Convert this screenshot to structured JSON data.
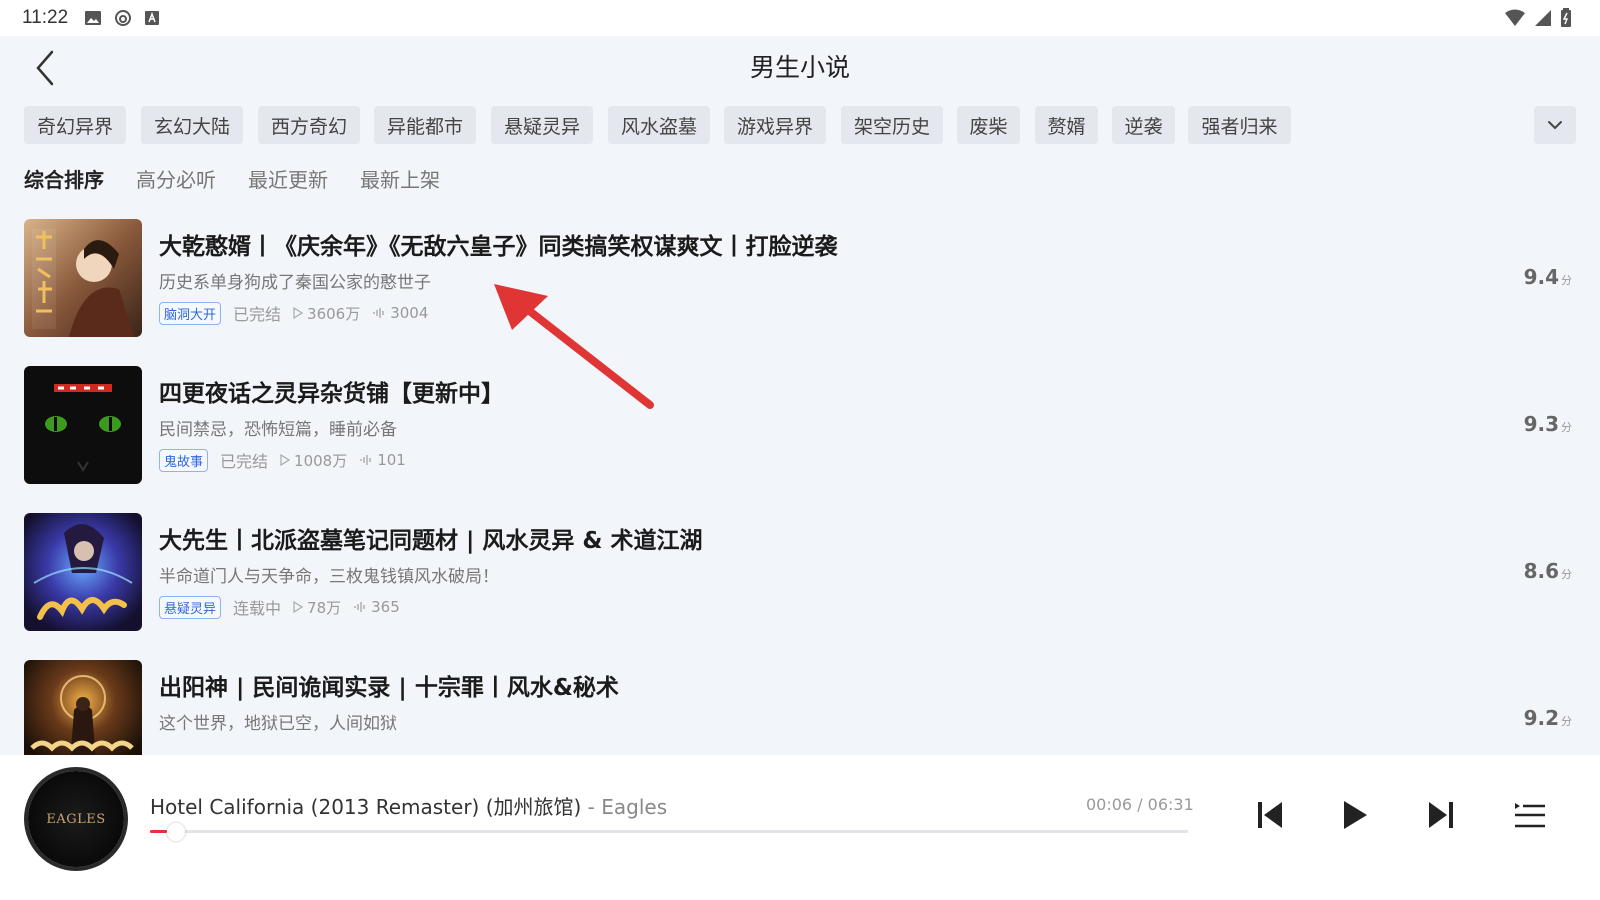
{
  "status_bar": {
    "time": "11:22"
  },
  "header": {
    "title": "男生小说"
  },
  "tags": [
    "奇幻异界",
    "玄幻大陆",
    "西方奇幻",
    "异能都市",
    "悬疑灵异",
    "风水盗墓",
    "游戏异界",
    "架空历史",
    "废柴",
    "赘婿",
    "逆袭",
    "强者归来"
  ],
  "sort_options": [
    "综合排序",
    "高分必听",
    "最近更新",
    "最新上架"
  ],
  "books": [
    {
      "title": "大乾憨婿丨《庆余年》《无敌六皇子》同类搞笑权谋爽文丨打脸逆袭",
      "desc": "历史系单身狗成了秦国公家的憨世子",
      "badge": "脑洞大开",
      "status": "已完结",
      "plays": "3606万",
      "count": "3004",
      "score": "9.4",
      "score_unit": "分"
    },
    {
      "title": "四更夜话之灵异杂货铺【更新中】",
      "desc": "民间禁忌，恐怖短篇，睡前必备",
      "badge": "鬼故事",
      "status": "已完结",
      "plays": "1008万",
      "count": "101",
      "score": "9.3",
      "score_unit": "分"
    },
    {
      "title": "大先生丨北派盗墓笔记同题材 | 风水灵异 & 术道江湖",
      "desc": "半命道门人与天争命，三枚鬼钱镇风水破局！",
      "badge": "悬疑灵异",
      "status": "连载中",
      "plays": "78万",
      "count": "365",
      "score": "8.6",
      "score_unit": "分"
    },
    {
      "title": "出阳神 | 民间诡闻实录 | 十宗罪丨风水&秘术",
      "desc": "这个世界，地狱已空，人间如狱",
      "badge": "",
      "status": "",
      "plays": "",
      "count": "",
      "score": "9.2",
      "score_unit": "分"
    }
  ],
  "player": {
    "track": "Hotel California (2013 Remaster) (加州旅馆)",
    "artist": " - Eagles",
    "disc_label": "EAGLES",
    "time": "00:06 / 06:31",
    "progress": 0.016
  },
  "colors": {
    "accent": "#e5323b",
    "badge": "#2e68d8",
    "background": "#f2f5fa"
  }
}
